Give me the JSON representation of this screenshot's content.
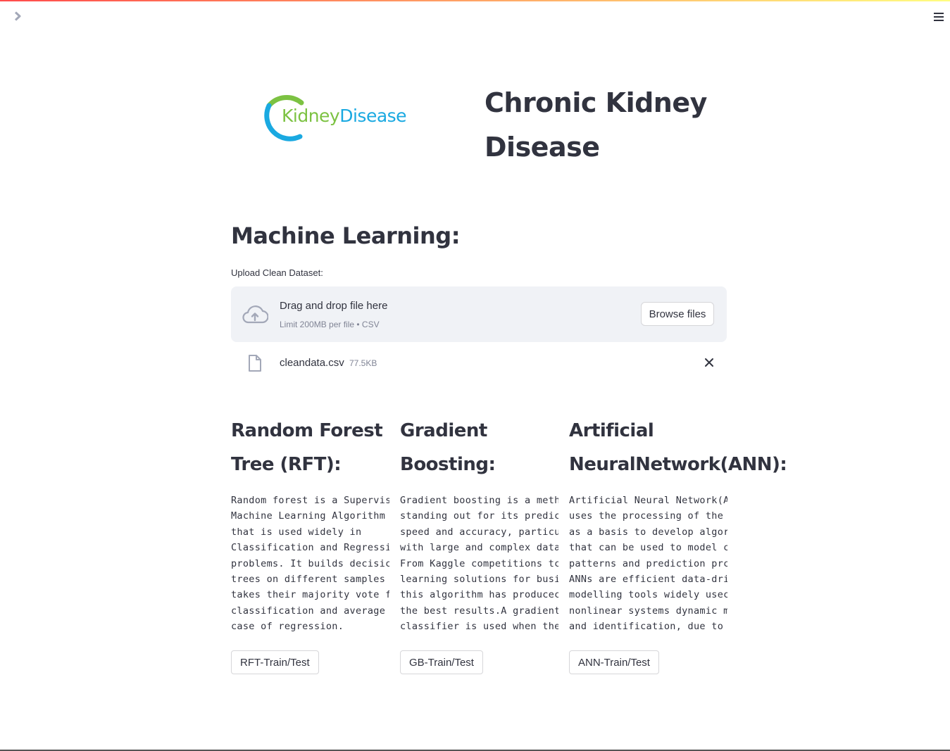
{
  "header": {
    "sidebar_toggle_icon": "chevron-right-icon",
    "menu_icon": "hamburger-menu-icon"
  },
  "logo": {
    "part1": "Kidney",
    "part2": "Disease",
    "colors": {
      "green": "#7cc242",
      "blue": "#1aa9e1"
    }
  },
  "app_title": "Chronic Kidney Disease",
  "main": {
    "section_title": "Machine Learning:",
    "uploader": {
      "label": "Upload Clean Dataset:",
      "drop_text": "Drag and drop file here",
      "hint": "Limit 200MB per file • CSV",
      "browse_label": "Browse files"
    },
    "uploaded_file": {
      "name": "cleandata.csv",
      "size": "77.5KB"
    }
  },
  "models": [
    {
      "heading": "Random Forest\nTree (RFT):",
      "description": "Random forest is a Supervis\nMachine Learning Algorithm\nthat is used widely in\nClassification and Regressi\nproblems. It builds decisic\ntrees on different samples\ntakes their majority vote f\nclassification and average\ncase of regression.",
      "button": "RFT-Train/Test"
    },
    {
      "heading": "Gradient\nBoosting:",
      "description": "Gradient boosting is a meth\nstanding out for its predic\nspeed and accuracy, particu\nwith large and complex data\nFrom Kaggle competitions tc\nlearning solutions for busi\nthis algorithm has producec\nthe best results.A gradient\nclassifier is used when the",
      "button": "GB-Train/Test"
    },
    {
      "heading": "Artificial\nNeuralNetwork(ANN):",
      "description": "Artificial Neural Network(A\nuses the processing of the\nas a basis to develop algor\nthat can be used to model c\npatterns and prediction prc\nANNs are efficient data-dri\nmodelling tools widely usec\nnonlinear systems dynamic m\nand identification, due to",
      "button": "ANN-Train/Test"
    }
  ],
  "colors": {
    "text": "#31333f",
    "muted": "#808495",
    "dropzone_bg": "#f0f2f6",
    "border": "#d6d6d9",
    "accent_start": "#ff4b4b",
    "accent_end": "#fffd80"
  }
}
